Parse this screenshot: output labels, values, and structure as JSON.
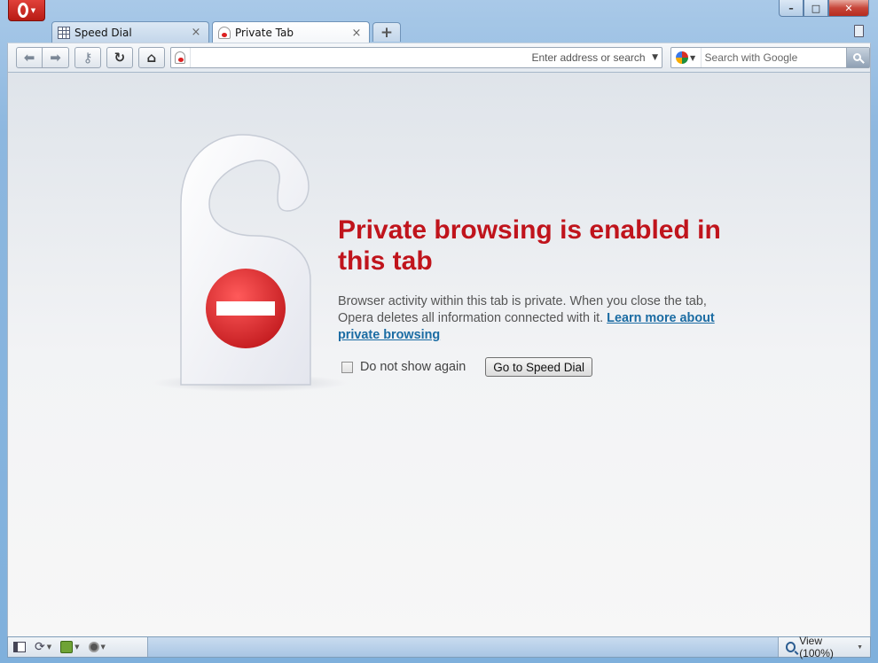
{
  "window": {
    "controls": {
      "minimize": "–",
      "maximize": "□",
      "close": "✕"
    }
  },
  "tabs": [
    {
      "label": "Speed Dial",
      "icon": "grid-icon",
      "close": "×",
      "active": false
    },
    {
      "label": "Private Tab",
      "icon": "private-icon",
      "close": "×",
      "active": true
    }
  ],
  "new_tab": "+",
  "toolbar": {
    "address": {
      "value": "",
      "hint": "Enter address or search"
    },
    "search": {
      "engine": "google-icon",
      "placeholder": "Search with Google"
    }
  },
  "content": {
    "headline": "Private browsing is enabled in this tab",
    "body_text": "Browser activity within this tab is private. When you close the tab, Opera deletes all information connected with it.",
    "learn_more": "Learn more about private browsing",
    "checkbox_label": "Do not show again",
    "checkbox_checked": false,
    "speed_dial_button": "Go to Speed Dial",
    "accent_color": "#c0141c",
    "link_color": "#1b6ca3"
  },
  "status_bar": {
    "zoom": "View (100%)"
  }
}
